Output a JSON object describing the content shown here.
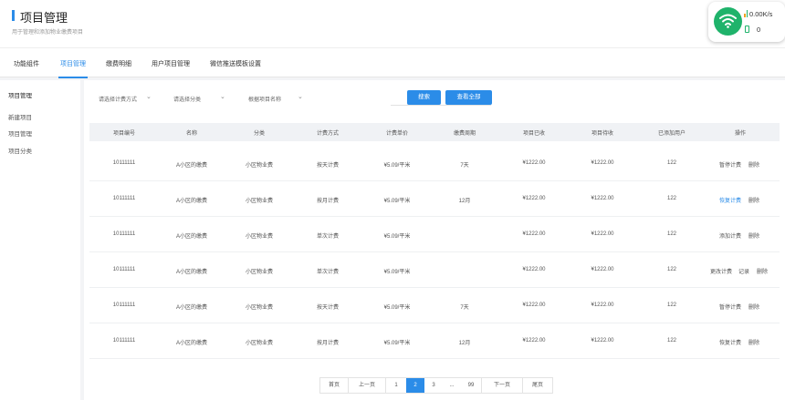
{
  "header": {
    "title": "项目管理",
    "subtitle": "用于管理和添加物业缴费项目"
  },
  "network": {
    "speed": "0.00K/s",
    "battery": "0",
    "icon": "wifi-icon",
    "accent": "#1fb36b"
  },
  "tabs": [
    {
      "label": "功能组件"
    },
    {
      "label": "项目管理"
    },
    {
      "label": "缴费明细"
    },
    {
      "label": "用户项目管理"
    },
    {
      "label": "微信推送模板设置"
    }
  ],
  "sidebar": {
    "heading": "项目管理",
    "items": [
      "新建项目",
      "项目管理",
      "项目分类"
    ]
  },
  "filters": {
    "method": "请选择计费方式",
    "category": "请选择分类",
    "name_placeholder": "根据项目名称",
    "search_button": "搜索",
    "view_all_button": "查看全部"
  },
  "table": {
    "headers": [
      "项目编号",
      "名称",
      "分类",
      "计费方式",
      "计费单价",
      "缴费周期",
      "项目已收",
      "项目待收",
      "已添加用户",
      "操作"
    ],
    "rows": [
      {
        "id": "10111111",
        "name": "A小区的缴费",
        "category": "小区物业费",
        "method": "按天计费",
        "price": "¥5.09/平米",
        "cycle": "7天",
        "received": "¥1222.00",
        "pending": "¥1222.00",
        "users": "122",
        "actions": [
          "暂停计费",
          "删除"
        ]
      },
      {
        "id": "10111111",
        "name": "A小区的缴费",
        "category": "小区物业费",
        "method": "按月计费",
        "price": "¥5.09/平米",
        "cycle": "12月",
        "received": "¥1222.00",
        "pending": "¥1222.00",
        "users": "122",
        "actions": [
          "恢复计费",
          "删除"
        ]
      },
      {
        "id": "10111111",
        "name": "A小区的缴费",
        "category": "小区物业费",
        "method": "单次计费",
        "price": "¥5.09/平米",
        "cycle": "",
        "received": "¥1222.00",
        "pending": "¥1222.00",
        "users": "122",
        "actions": [
          "添加计费",
          "删除"
        ]
      },
      {
        "id": "10111111",
        "name": "A小区的缴费",
        "category": "小区物业费",
        "method": "单次计费",
        "price": "¥5.09/平米",
        "cycle": "",
        "received": "¥1222.00",
        "pending": "¥1222.00",
        "users": "122",
        "actions": [
          "更改计费",
          "记录",
          "删除"
        ]
      },
      {
        "id": "10111111",
        "name": "A小区的缴费",
        "category": "小区物业费",
        "method": "按天计费",
        "price": "¥5.09/平米",
        "cycle": "7天",
        "received": "¥1222.00",
        "pending": "¥1222.00",
        "users": "122",
        "actions": [
          "暂停计费",
          "删除"
        ]
      },
      {
        "id": "10111111",
        "name": "A小区的缴费",
        "category": "小区物业费",
        "method": "按月计费",
        "price": "¥5.09/平米",
        "cycle": "12月",
        "received": "¥1222.00",
        "pending": "¥1222.00",
        "users": "122",
        "actions": [
          "恢复计费",
          "删除"
        ]
      }
    ]
  },
  "pagination": {
    "first": "首页",
    "prev": "上一页",
    "pages": [
      "1",
      "2",
      "3",
      "...",
      "99"
    ],
    "current": "2",
    "next": "下一页",
    "last": "尾页"
  },
  "colors": {
    "accent": "#2b8ce8"
  }
}
